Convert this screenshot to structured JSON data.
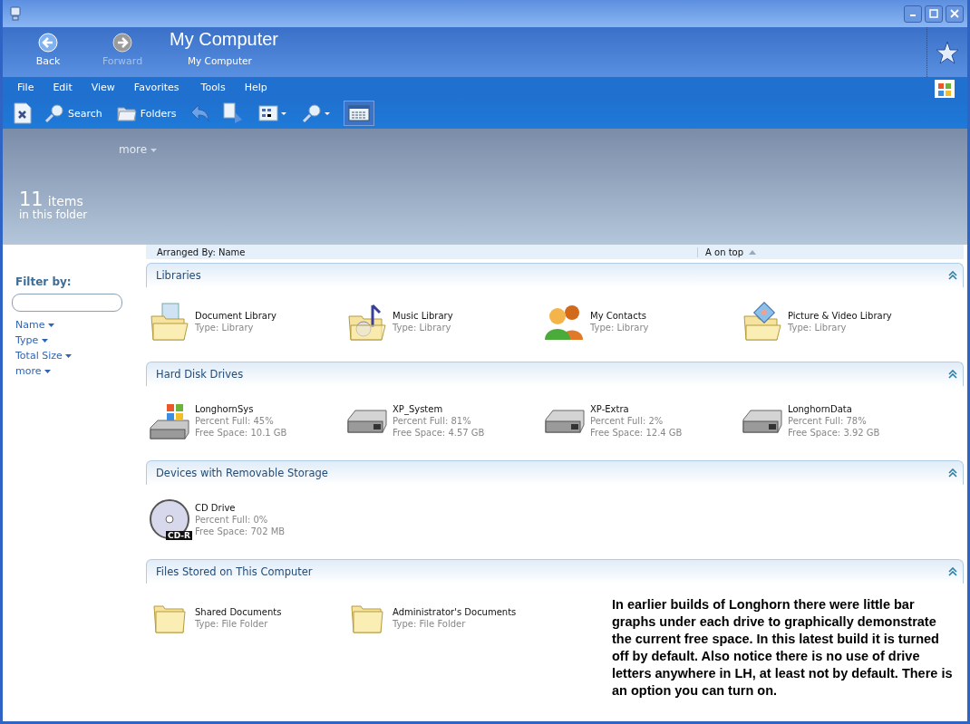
{
  "header": {
    "back": "Back",
    "forward": "Forward",
    "forward_disabled": true,
    "title": "My Computer",
    "breadcrumb": "My Computer"
  },
  "menu": [
    "File",
    "Edit",
    "View",
    "Favorites",
    "Tools",
    "Help"
  ],
  "toolbar": {
    "search": "Search",
    "folders": "Folders"
  },
  "banner": {
    "more": "more",
    "count": "11",
    "count_unit": "items",
    "subtitle": "in this folder"
  },
  "filter": {
    "title": "Filter by:",
    "options": [
      "Name",
      "Type",
      "Total Size",
      "more"
    ]
  },
  "arrange": {
    "label": "Arranged By: Name",
    "sort": "A on top"
  },
  "groups": [
    {
      "title": "Libraries",
      "items": [
        {
          "kind": "document-library",
          "name": "Document Library",
          "details": [
            "Type: Library"
          ]
        },
        {
          "kind": "music-library",
          "name": "Music Library",
          "details": [
            "Type: Library"
          ]
        },
        {
          "kind": "contacts",
          "name": "My Contacts",
          "details": [
            "Type: Library"
          ]
        },
        {
          "kind": "picture-library",
          "name": "Picture & Video Library",
          "details": [
            "Type: Library"
          ]
        }
      ]
    },
    {
      "title": "Hard Disk Drives",
      "items": [
        {
          "kind": "system-drive",
          "name": "LonghornSys",
          "details": [
            "Percent Full: 45%",
            "Free Space: 10.1 GB"
          ]
        },
        {
          "kind": "drive",
          "name": "XP_System",
          "details": [
            "Percent Full: 81%",
            "Free Space: 4.57 GB"
          ]
        },
        {
          "kind": "drive",
          "name": "XP-Extra",
          "details": [
            "Percent Full: 2%",
            "Free Space: 12.4 GB"
          ]
        },
        {
          "kind": "drive",
          "name": "LonghornData",
          "details": [
            "Percent Full: 78%",
            "Free Space: 3.92 GB"
          ]
        }
      ]
    },
    {
      "title": "Devices with Removable Storage",
      "items": [
        {
          "kind": "cd",
          "name": "CD Drive",
          "badge": "CD-R",
          "details": [
            "Percent Full: 0%",
            "Free Space: 702 MB"
          ]
        }
      ]
    },
    {
      "title": "Files Stored on This Computer",
      "items": [
        {
          "kind": "folder",
          "name": "Shared Documents",
          "details": [
            "Type: File Folder"
          ]
        },
        {
          "kind": "folder",
          "name": "Administrator's Documents",
          "details": [
            "Type: File Folder"
          ]
        }
      ]
    }
  ],
  "annotation": "In earlier builds of Longhorn there were little bar graphs under each drive to graphically demonstrate the current free space.  In this latest build it is turned off by default.  Also notice there is no use of drive letters anywhere in LH, at least not by default.  There is an option you can turn on."
}
